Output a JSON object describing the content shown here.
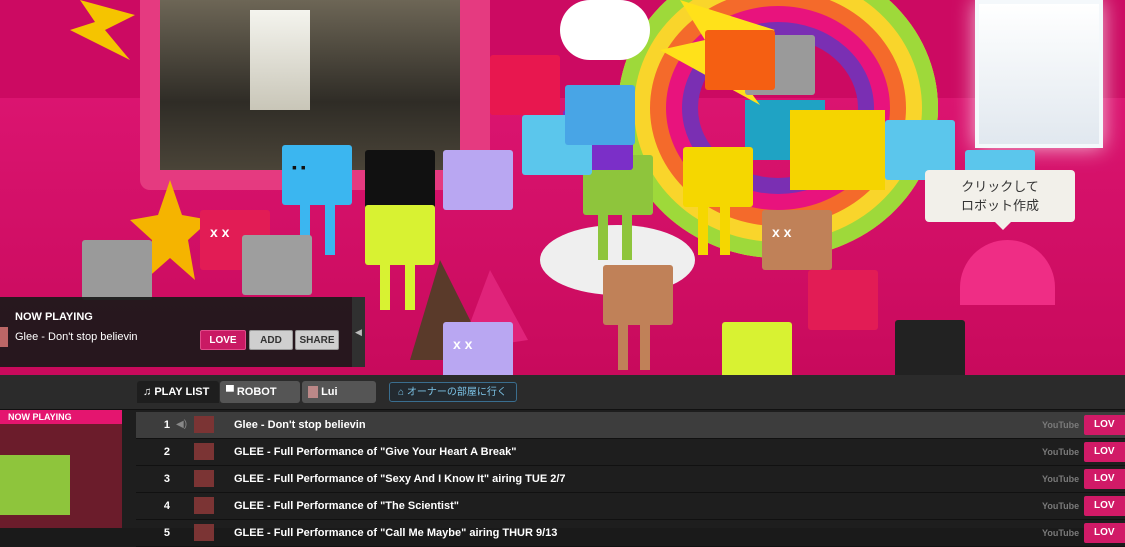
{
  "scene": {
    "tooltip": {
      "line1": "クリックして",
      "line2": "ロボット作成"
    },
    "robot_faces": [
      "x x",
      "x x",
      "x x"
    ]
  },
  "now_playing_overlay": {
    "title": "NOW PLAYING",
    "track": "Glee - Don't stop believin",
    "love_label": "LOVE",
    "add_label": "ADD",
    "share_label": "SHARE",
    "collapse_glyph": "◀"
  },
  "tabs": {
    "playlist": "PLAY LIST",
    "robot": "ROBOT",
    "user": "Lui",
    "owner_room": "オーナーの部屋に行く"
  },
  "side": {
    "now_playing_label": "NOW PLAYING"
  },
  "playlist": [
    {
      "num": "1",
      "title": "Glee - Don't stop believin",
      "source": "YouTube",
      "love": "LOV",
      "active": true
    },
    {
      "num": "2",
      "title": "GLEE - Full Performance of \"Give Your Heart A Break\"",
      "source": "YouTube",
      "love": "LOV"
    },
    {
      "num": "3",
      "title": "GLEE - Full Performance of \"Sexy And I Know It\" airing TUE 2/7",
      "source": "YouTube",
      "love": "LOV"
    },
    {
      "num": "4",
      "title": "GLEE - Full Performance of \"The Scientist\"",
      "source": "YouTube",
      "love": "LOV"
    },
    {
      "num": "5",
      "title": "GLEE - Full Performance of \"Call Me Maybe\" airing THUR 9/13",
      "source": "YouTube",
      "love": "LOV"
    }
  ],
  "colors": {
    "accent": "#d11a67",
    "floor": "#d4085f"
  }
}
